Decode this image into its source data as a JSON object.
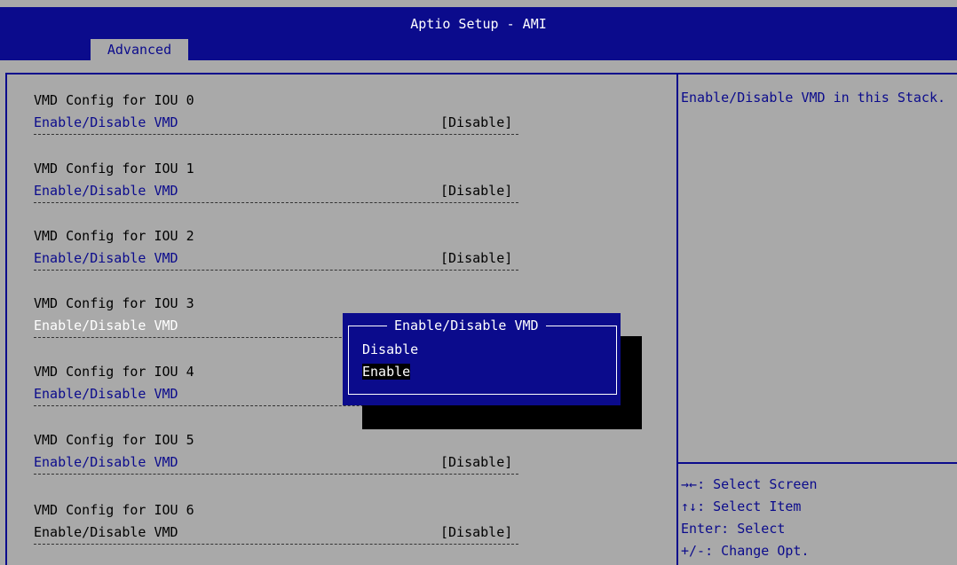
{
  "header": {
    "title": "Aptio Setup - AMI",
    "active_tab": "Advanced"
  },
  "groups": [
    {
      "header": "VMD Config for IOU 0",
      "label": "Enable/Disable VMD",
      "value": "[Disable]"
    },
    {
      "header": "VMD Config for IOU 1",
      "label": "Enable/Disable VMD",
      "value": "[Disable]"
    },
    {
      "header": "VMD Config for IOU 2",
      "label": "Enable/Disable VMD",
      "value": "[Disable]"
    },
    {
      "header": "VMD Config for IOU 3",
      "label": "Enable/Disable VMD",
      "value": ""
    },
    {
      "header": "VMD Config for IOU 4",
      "label": "Enable/Disable VMD",
      "value": ""
    },
    {
      "header": "VMD Config for IOU 5",
      "label": "Enable/Disable VMD",
      "value": "[Disable]"
    },
    {
      "header": "VMD Config for IOU 6",
      "label": "Enable/Disable VMD",
      "value": "[Disable]"
    }
  ],
  "help_text": "Enable/Disable VMD in this Stack.",
  "keys": [
    {
      "symbol": "→←",
      "text": ": Select Screen"
    },
    {
      "symbol": "↑↓",
      "text": ": Select Item"
    },
    {
      "symbol": "",
      "text": "Enter: Select"
    },
    {
      "symbol": "",
      "text": "+/-: Change Opt."
    }
  ],
  "popup": {
    "title": "Enable/Disable VMD",
    "options": [
      "Disable",
      "Enable"
    ],
    "selected_index": 1
  },
  "colors": {
    "primary_blue": "#0b0b8c",
    "background_gray": "#a9a9a9",
    "highlight": "#ffffff"
  }
}
